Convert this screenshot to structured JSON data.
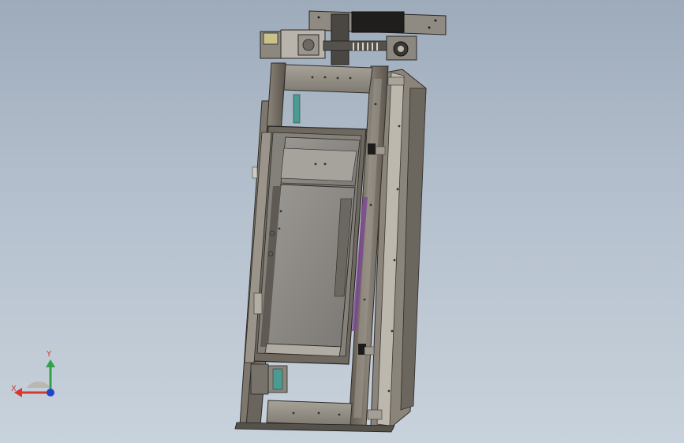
{
  "viewport": {
    "colors": {
      "background_top": "#9eabbb",
      "background_bottom": "#c8d2dc",
      "steel": "#6f685e",
      "steel_light": "#a19b90",
      "steel_dark": "#3c3935",
      "panel": "#8d8a86",
      "window": "#a8b4c1",
      "rail_cyan": "#4c9a94",
      "accent_purple": "#7c4b8f",
      "black": "#1c1b1a"
    }
  },
  "triad": {
    "x_label": "X",
    "y_label": "Y",
    "x_color": "#d6382c",
    "y_color": "#2fa24a",
    "z_color": "#2244cc"
  }
}
